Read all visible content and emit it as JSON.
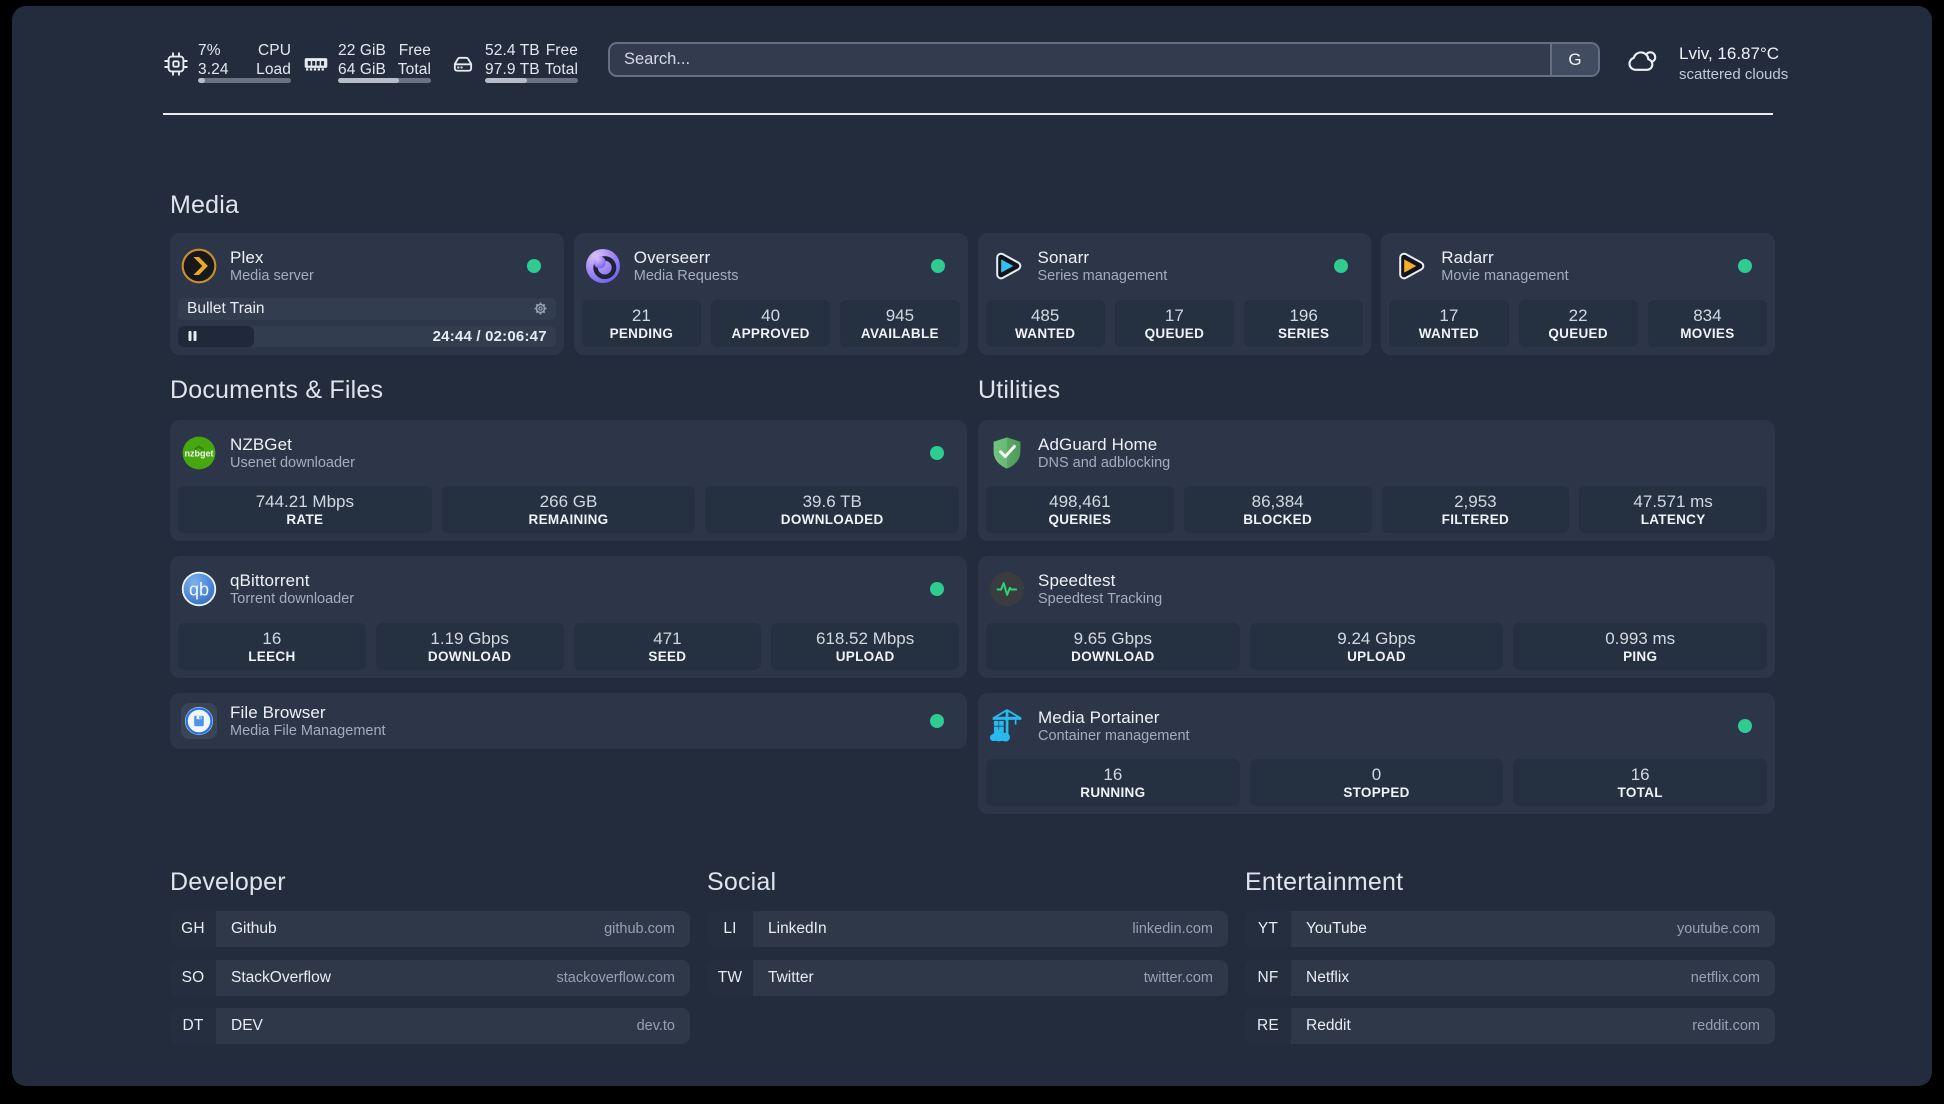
{
  "colors": {
    "status_online": "#2ecc8f",
    "panel_bg": "#222c3d",
    "card_bg": "#2c3648"
  },
  "topbar": {
    "resources": [
      {
        "icon": "cpu-icon",
        "rows": [
          {
            "value": "7%",
            "label": "CPU"
          },
          {
            "value": "3.24",
            "label": "Load"
          }
        ],
        "progress_pct": 8
      },
      {
        "icon": "memory-icon",
        "rows": [
          {
            "value": "22 GiB",
            "label": "Free"
          },
          {
            "value": "64 GiB",
            "label": "Total"
          }
        ],
        "progress_pct": 65.6
      },
      {
        "icon": "disk-icon",
        "rows": [
          {
            "value": "52.4 TB",
            "label": "Free"
          },
          {
            "value": "97.9 TB",
            "label": "Total"
          }
        ],
        "progress_pct": 45
      }
    ],
    "search": {
      "placeholder": "Search...",
      "provider_button": "G"
    },
    "weather": {
      "location": "Lviv, 16.87°C",
      "condition": "scattered clouds"
    }
  },
  "groups": {
    "media": {
      "title": "Media",
      "services": [
        {
          "title": "Plex",
          "subtitle": "Media server",
          "status": "online",
          "player": {
            "track": "Bullet Train",
            "time": "24:44 / 02:06:47"
          }
        },
        {
          "title": "Overseerr",
          "subtitle": "Media Requests",
          "status": "online",
          "stats": [
            {
              "value": "21",
              "label": "PENDING"
            },
            {
              "value": "40",
              "label": "APPROVED"
            },
            {
              "value": "945",
              "label": "AVAILABLE"
            }
          ]
        },
        {
          "title": "Sonarr",
          "subtitle": "Series management",
          "status": "online",
          "stats": [
            {
              "value": "485",
              "label": "WANTED"
            },
            {
              "value": "17",
              "label": "QUEUED"
            },
            {
              "value": "196",
              "label": "SERIES"
            }
          ]
        },
        {
          "title": "Radarr",
          "subtitle": "Movie management",
          "status": "online",
          "stats": [
            {
              "value": "17",
              "label": "WANTED"
            },
            {
              "value": "22",
              "label": "QUEUED"
            },
            {
              "value": "834",
              "label": "MOVIES"
            }
          ]
        }
      ]
    },
    "documents": {
      "title": "Documents & Files",
      "services": [
        {
          "title": "NZBGet",
          "subtitle": "Usenet downloader",
          "status": "online",
          "stats": [
            {
              "value": "744.21 Mbps",
              "label": "RATE"
            },
            {
              "value": "266 GB",
              "label": "REMAINING"
            },
            {
              "value": "39.6 TB",
              "label": "DOWNLOADED"
            }
          ]
        },
        {
          "title": "qBittorrent",
          "subtitle": "Torrent downloader",
          "status": "online",
          "stats": [
            {
              "value": "16",
              "label": "LEECH"
            },
            {
              "value": "1.19 Gbps",
              "label": "DOWNLOAD"
            },
            {
              "value": "471",
              "label": "SEED"
            },
            {
              "value": "618.52 Mbps",
              "label": "UPLOAD"
            }
          ]
        },
        {
          "title": "File Browser",
          "subtitle": "Media File Management",
          "status": "online"
        }
      ]
    },
    "utilities": {
      "title": "Utilities",
      "services": [
        {
          "title": "AdGuard Home",
          "subtitle": "DNS and adblocking",
          "stats": [
            {
              "value": "498,461",
              "label": "QUERIES"
            },
            {
              "value": "86,384",
              "label": "BLOCKED"
            },
            {
              "value": "2,953",
              "label": "FILTERED"
            },
            {
              "value": "47.571 ms",
              "label": "LATENCY"
            }
          ]
        },
        {
          "title": "Speedtest",
          "subtitle": "Speedtest Tracking",
          "stats": [
            {
              "value": "9.65 Gbps",
              "label": "DOWNLOAD"
            },
            {
              "value": "9.24 Gbps",
              "label": "UPLOAD"
            },
            {
              "value": "0.993 ms",
              "label": "PING"
            }
          ]
        },
        {
          "title": "Media Portainer",
          "subtitle": "Container management",
          "status": "online",
          "stats": [
            {
              "value": "16",
              "label": "RUNNING"
            },
            {
              "value": "0",
              "label": "STOPPED"
            },
            {
              "value": "16",
              "label": "TOTAL"
            }
          ]
        }
      ]
    }
  },
  "bookmarks": [
    {
      "title": "Developer",
      "links": [
        {
          "abbr": "GH",
          "name": "Github",
          "url": "github.com"
        },
        {
          "abbr": "SO",
          "name": "StackOverflow",
          "url": "stackoverflow.com"
        },
        {
          "abbr": "DT",
          "name": "DEV",
          "url": "dev.to"
        }
      ]
    },
    {
      "title": "Social",
      "links": [
        {
          "abbr": "LI",
          "name": "LinkedIn",
          "url": "linkedin.com"
        },
        {
          "abbr": "TW",
          "name": "Twitter",
          "url": "twitter.com"
        }
      ]
    },
    {
      "title": "Entertainment",
      "links": [
        {
          "abbr": "YT",
          "name": "YouTube",
          "url": "youtube.com"
        },
        {
          "abbr": "NF",
          "name": "Netflix",
          "url": "netflix.com"
        },
        {
          "abbr": "RE",
          "name": "Reddit",
          "url": "reddit.com"
        }
      ]
    }
  ]
}
